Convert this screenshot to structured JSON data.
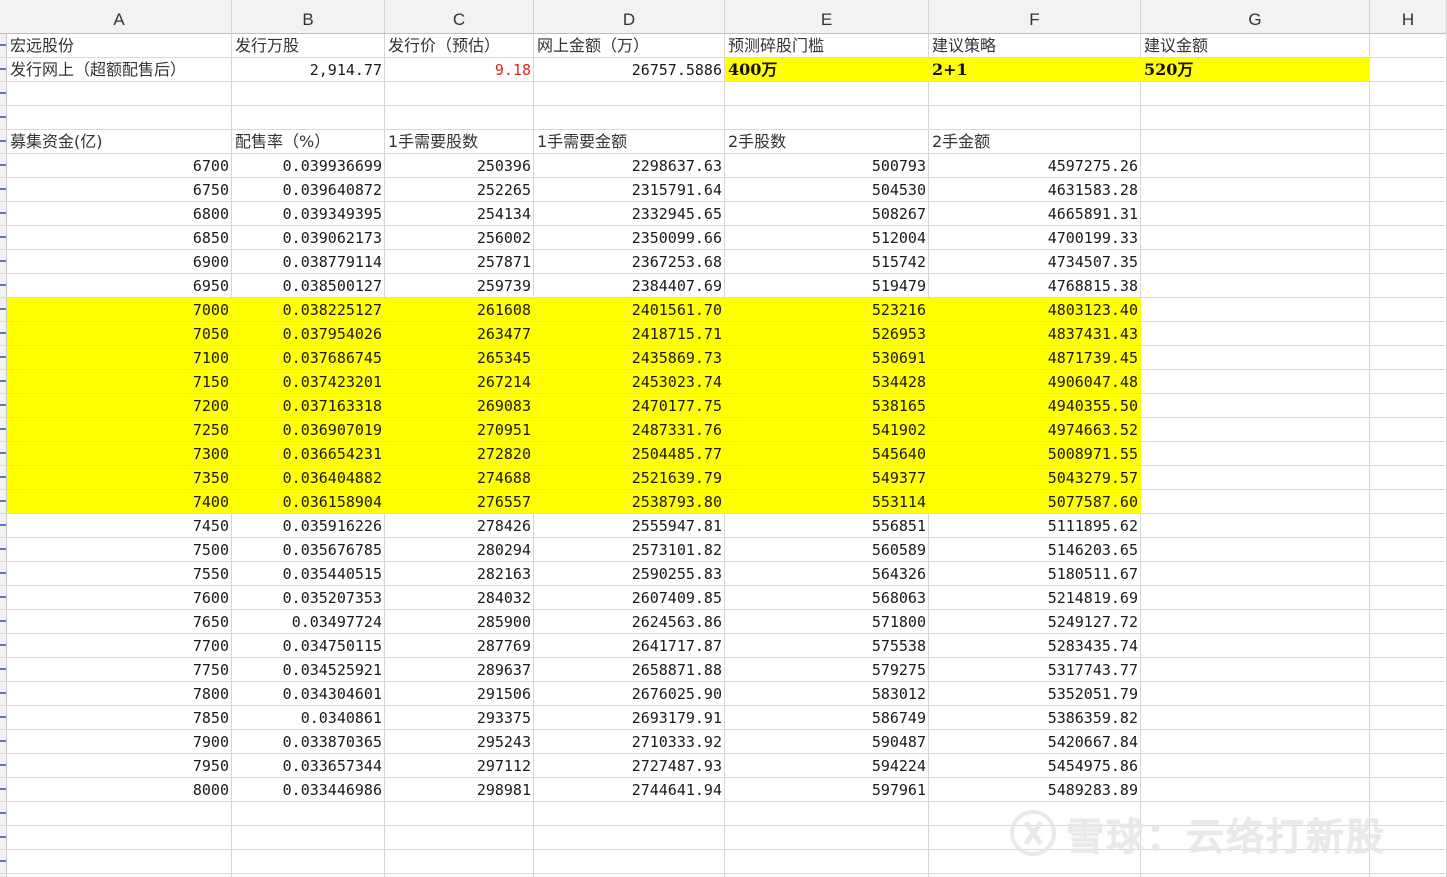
{
  "columns": [
    "A",
    "B",
    "C",
    "D",
    "E",
    "F",
    "G",
    "H"
  ],
  "colors": {
    "highlight": "#ffff00",
    "price_red": "#e0261b"
  },
  "info_header": {
    "a": "宏远股份",
    "b": "发行万股",
    "c": "发行价（预估）",
    "d": "网上金额（万）",
    "e": "预测碎股门槛",
    "f": "建议策略",
    "g": "建议金额"
  },
  "info_values": {
    "a": "发行网上（超额配售后）",
    "b": "2,914.77",
    "c": "9.18",
    "d": "26757.5886",
    "e": "400万",
    "f": "2+1",
    "g": "520万"
  },
  "table_header": {
    "a": "募集资金(亿)",
    "b": "配售率（%）",
    "c": "1手需要股数",
    "d": "1手需要金额",
    "e": "2手股数",
    "f": "2手金额"
  },
  "rows": [
    {
      "a": "6700",
      "b": "0.039936699",
      "c": "250396",
      "d": "2298637.63",
      "e": "500793",
      "f": "4597275.26"
    },
    {
      "a": "6750",
      "b": "0.039640872",
      "c": "252265",
      "d": "2315791.64",
      "e": "504530",
      "f": "4631583.28"
    },
    {
      "a": "6800",
      "b": "0.039349395",
      "c": "254134",
      "d": "2332945.65",
      "e": "508267",
      "f": "4665891.31"
    },
    {
      "a": "6850",
      "b": "0.039062173",
      "c": "256002",
      "d": "2350099.66",
      "e": "512004",
      "f": "4700199.33"
    },
    {
      "a": "6900",
      "b": "0.038779114",
      "c": "257871",
      "d": "2367253.68",
      "e": "515742",
      "f": "4734507.35"
    },
    {
      "a": "6950",
      "b": "0.038500127",
      "c": "259739",
      "d": "2384407.69",
      "e": "519479",
      "f": "4768815.38"
    },
    {
      "a": "7000",
      "b": "0.038225127",
      "c": "261608",
      "d": "2401561.70",
      "e": "523216",
      "f": "4803123.40"
    },
    {
      "a": "7050",
      "b": "0.037954026",
      "c": "263477",
      "d": "2418715.71",
      "e": "526953",
      "f": "4837431.43"
    },
    {
      "a": "7100",
      "b": "0.037686745",
      "c": "265345",
      "d": "2435869.73",
      "e": "530691",
      "f": "4871739.45"
    },
    {
      "a": "7150",
      "b": "0.037423201",
      "c": "267214",
      "d": "2453023.74",
      "e": "534428",
      "f": "4906047.48"
    },
    {
      "a": "7200",
      "b": "0.037163318",
      "c": "269083",
      "d": "2470177.75",
      "e": "538165",
      "f": "4940355.50"
    },
    {
      "a": "7250",
      "b": "0.036907019",
      "c": "270951",
      "d": "2487331.76",
      "e": "541902",
      "f": "4974663.52"
    },
    {
      "a": "7300",
      "b": "0.036654231",
      "c": "272820",
      "d": "2504485.77",
      "e": "545640",
      "f": "5008971.55"
    },
    {
      "a": "7350",
      "b": "0.036404882",
      "c": "274688",
      "d": "2521639.79",
      "e": "549377",
      "f": "5043279.57"
    },
    {
      "a": "7400",
      "b": "0.036158904",
      "c": "276557",
      "d": "2538793.80",
      "e": "553114",
      "f": "5077587.60"
    },
    {
      "a": "7450",
      "b": "0.035916226",
      "c": "278426",
      "d": "2555947.81",
      "e": "556851",
      "f": "5111895.62"
    },
    {
      "a": "7500",
      "b": "0.035676785",
      "c": "280294",
      "d": "2573101.82",
      "e": "560589",
      "f": "5146203.65"
    },
    {
      "a": "7550",
      "b": "0.035440515",
      "c": "282163",
      "d": "2590255.83",
      "e": "564326",
      "f": "5180511.67"
    },
    {
      "a": "7600",
      "b": "0.035207353",
      "c": "284032",
      "d": "2607409.85",
      "e": "568063",
      "f": "5214819.69"
    },
    {
      "a": "7650",
      "b": "0.03497724",
      "c": "285900",
      "d": "2624563.86",
      "e": "571800",
      "f": "5249127.72"
    },
    {
      "a": "7700",
      "b": "0.034750115",
      "c": "287769",
      "d": "2641717.87",
      "e": "575538",
      "f": "5283435.74"
    },
    {
      "a": "7750",
      "b": "0.034525921",
      "c": "289637",
      "d": "2658871.88",
      "e": "579275",
      "f": "5317743.77"
    },
    {
      "a": "7800",
      "b": "0.034304601",
      "c": "291506",
      "d": "2676025.90",
      "e": "583012",
      "f": "5352051.79"
    },
    {
      "a": "7850",
      "b": "0.0340861",
      "c": "293375",
      "d": "2693179.91",
      "e": "586749",
      "f": "5386359.82"
    },
    {
      "a": "7900",
      "b": "0.033870365",
      "c": "295243",
      "d": "2710333.92",
      "e": "590487",
      "f": "5420667.84"
    },
    {
      "a": "7950",
      "b": "0.033657344",
      "c": "297112",
      "d": "2727487.93",
      "e": "594224",
      "f": "5454975.86"
    },
    {
      "a": "8000",
      "b": "0.033446986",
      "c": "298981",
      "d": "2744641.94",
      "e": "597961",
      "f": "5489283.89"
    }
  ],
  "highlighted_rows": [
    "7000",
    "7050",
    "7100",
    "7150",
    "7200",
    "7250",
    "7300",
    "7350",
    "7400"
  ],
  "watermark": "雪球：云络打新股"
}
